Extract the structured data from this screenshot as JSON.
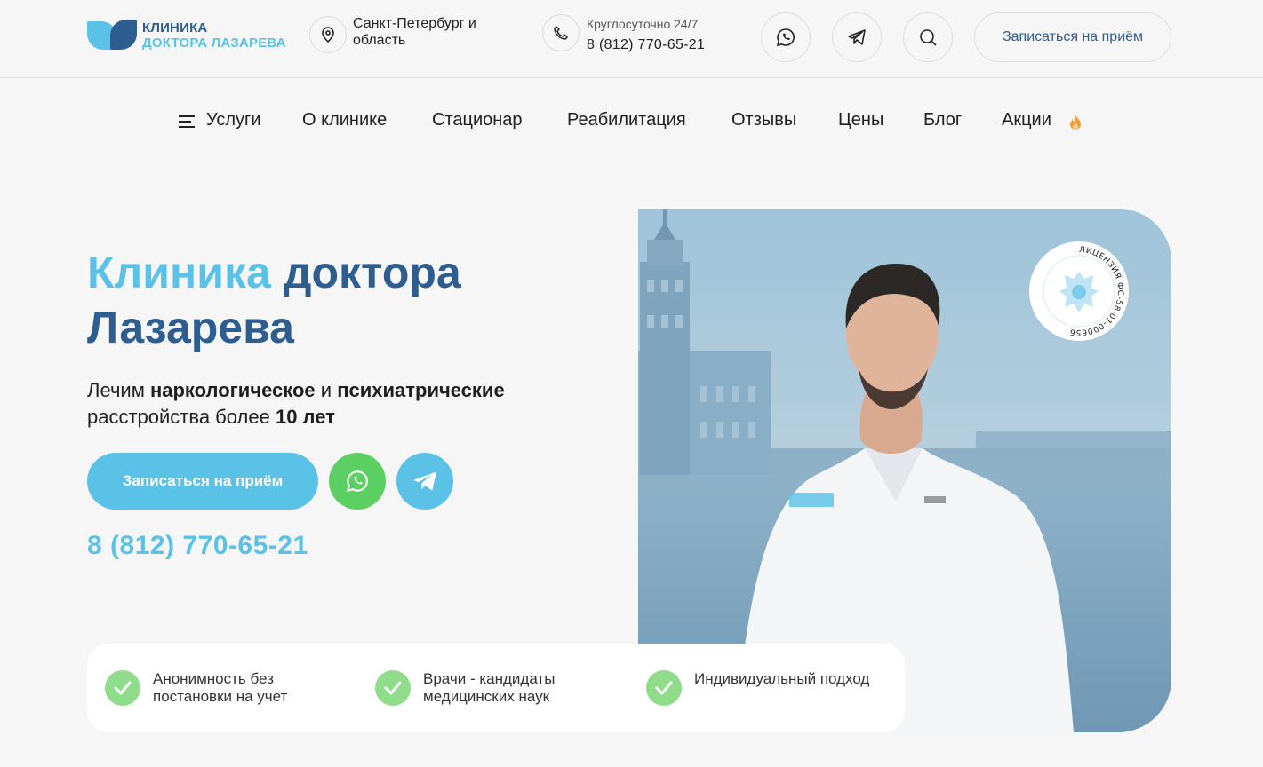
{
  "header": {
    "logo": {
      "line1": "КЛИНИКА",
      "line2": "ДОКТОРА ЛАЗАРЕВА"
    },
    "location": "Санкт-Петербург и область",
    "phone_label": "Круглосуточно 24/7",
    "phone": "8 (812) 770-65-21",
    "cta_label": "Записаться на приём"
  },
  "nav": {
    "items": [
      {
        "label": "Услуги"
      },
      {
        "label": "О клинике"
      },
      {
        "label": "Стационар"
      },
      {
        "label": "Реабилитация"
      },
      {
        "label": "Отзывы"
      },
      {
        "label": "Цены"
      },
      {
        "label": "Блог"
      },
      {
        "label": "Акции"
      }
    ]
  },
  "hero": {
    "title_accent": "Клиника",
    "title_rest1": "доктора",
    "title_rest2": "Лазарева",
    "sub_1": "Лечим ",
    "sub_b1": "наркологическое",
    "sub_2": " и ",
    "sub_b2": "психиатрические",
    "sub_3": " расстройства более ",
    "sub_b3": "10 лет",
    "cta_label": "Записаться на приём",
    "phone": "8 (812) 770-65-21",
    "badge_text": "ЛИЦЕНЗИЯ ФС-58-01-000656"
  },
  "features": [
    {
      "text": "Анонимность без постановки на учет"
    },
    {
      "text": "Врачи - кандидаты медицинских наук"
    },
    {
      "text": "Индивидуальный подход"
    }
  ],
  "colors": {
    "brand_dark": "#2e5d8f",
    "brand_light": "#5bc2e7",
    "whatsapp": "#5ccf63",
    "check": "#8fdc8a"
  }
}
